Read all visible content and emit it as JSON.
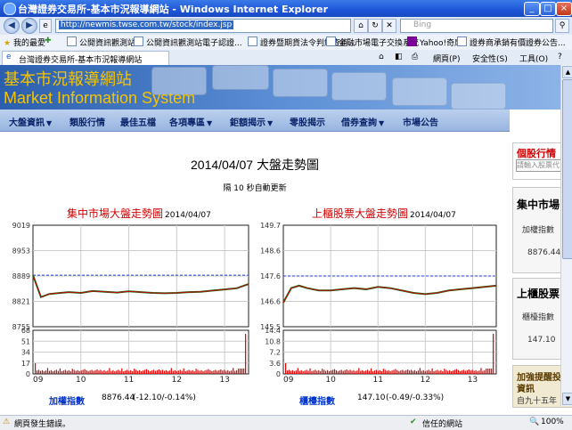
{
  "window": {
    "title": "台灣證券交易所-基本市況報導網站 - Windows Internet Explorer",
    "minimize": "_",
    "maximize": "□",
    "close": "×"
  },
  "address": {
    "url": "http://newmis.twse.com.tw/stock/index.jsp",
    "search_placeholder": "Bing"
  },
  "favorites": {
    "label": "我的最愛",
    "items": [
      "公開資訊觀測站",
      "公開資訊觀測站電子認證...",
      "證券暨期貨法令判解查詢...",
      "金融市場電子交換系統",
      "Yahoo!奇摩",
      "證券商承銷有價證券公告..."
    ]
  },
  "tab": {
    "label": "台灣證券交易所-基本市況報導網站",
    "tools": [
      "網頁(P)",
      "安全性(S)",
      "工具(O)"
    ]
  },
  "site": {
    "title_cn": "基本市況報導網站",
    "title_en": "Market Information System"
  },
  "nav": [
    {
      "label": "大盤資訊",
      "dropdown": true
    },
    {
      "label": "類股行情",
      "dropdown": false
    },
    {
      "label": "最佳五檔",
      "dropdown": false
    },
    {
      "label": "各項專區",
      "dropdown": true
    },
    {
      "label": "鉅額揭示",
      "dropdown": true
    },
    {
      "label": "零股揭示",
      "dropdown": false
    },
    {
      "label": "借券查詢",
      "dropdown": true
    },
    {
      "label": "市場公告",
      "dropdown": false
    }
  ],
  "main": {
    "title": "2014/04/07 大盤走勢圖",
    "refresh": "隔 10 秒自動更新"
  },
  "charts": [
    {
      "title": "集中市場大盤走勢圖",
      "date": "2014/04/07",
      "price_ticks": [
        "9019",
        "8953",
        "8889",
        "8821",
        "8755"
      ],
      "volume_ticks": [
        "68",
        "51",
        "34",
        "17",
        "0"
      ],
      "x_ticks": [
        "09",
        "10",
        "11",
        "12",
        "13"
      ],
      "index_label": "加權指數",
      "index_value": "8876.44",
      "index_change": "(-12.10/-0.14%)"
    },
    {
      "title": "上櫃股票大盤走勢圖",
      "date": "2014/04/07",
      "price_ticks": [
        "149.7",
        "148.6",
        "147.6",
        "146.6",
        "145.5"
      ],
      "volume_ticks": [
        "14.4",
        "10.8",
        "7.2",
        "3.6",
        "0"
      ],
      "x_ticks": [
        "09",
        "10",
        "11",
        "12",
        "13"
      ],
      "index_label": "櫃檯指數",
      "index_value": "147.10",
      "index_change": "(-0.49/-0.33%)"
    }
  ],
  "chart_data": [
    {
      "type": "line",
      "title": "集中市場大盤走勢圖",
      "x": [
        "09:00",
        "09:10",
        "09:20",
        "09:30",
        "09:45",
        "10:00",
        "10:15",
        "10:30",
        "10:45",
        "11:00",
        "11:15",
        "11:30",
        "11:45",
        "12:00",
        "12:15",
        "12:30",
        "12:45",
        "13:00",
        "13:15",
        "13:30"
      ],
      "series": [
        {
          "name": "加權指數",
          "values": [
            8889,
            8832,
            8840,
            8842,
            8845,
            8843,
            8848,
            8846,
            8844,
            8847,
            8845,
            8843,
            8842,
            8843,
            8845,
            8846,
            8849,
            8852,
            8855,
            8866
          ]
        }
      ],
      "reference_line": 8889,
      "ylim": [
        8755,
        9019
      ],
      "volume_ylim": [
        0,
        68
      ]
    },
    {
      "type": "line",
      "title": "上櫃股票大盤走勢圖",
      "x": [
        "09:00",
        "09:10",
        "09:20",
        "09:30",
        "09:45",
        "10:00",
        "10:15",
        "10:30",
        "10:45",
        "11:00",
        "11:15",
        "11:30",
        "11:45",
        "12:00",
        "12:15",
        "12:30",
        "12:45",
        "13:00",
        "13:15",
        "13:30"
      ],
      "series": [
        {
          "name": "櫃檯指數",
          "values": [
            146.5,
            147.1,
            147.2,
            147.1,
            147.0,
            147.0,
            147.05,
            147.1,
            147.05,
            147.15,
            147.1,
            147.0,
            146.9,
            146.85,
            146.9,
            147.0,
            147.05,
            147.1,
            147.15,
            147.2
          ]
        }
      ],
      "reference_line": 147.6,
      "ylim": [
        145.5,
        149.7
      ],
      "volume_ylim": [
        0,
        14.4
      ]
    }
  ],
  "sidebar": {
    "quote_head": "個股行情",
    "quote_input_placeholder": "請輸入股票代",
    "panel1_head": "集中市場",
    "panel1_sub": "加權指數",
    "panel1_val": "8876.44",
    "panel2_head": "上櫃股票",
    "panel2_sub": "櫃檯指數",
    "panel2_val": "147.10",
    "notice_head": "加強提醒投",
    "notice_sub": "資訊",
    "notice_body": "自九十五年"
  },
  "status": {
    "left": "網頁發生錯誤。",
    "zone": "信任的網站",
    "zoom": "100%"
  },
  "colors": {
    "title_red": "#d00000",
    "index_blue": "#0033cc",
    "line_green": "#007a1f",
    "line_red": "#cc0000",
    "ref_blue": "#2a3fd8"
  }
}
